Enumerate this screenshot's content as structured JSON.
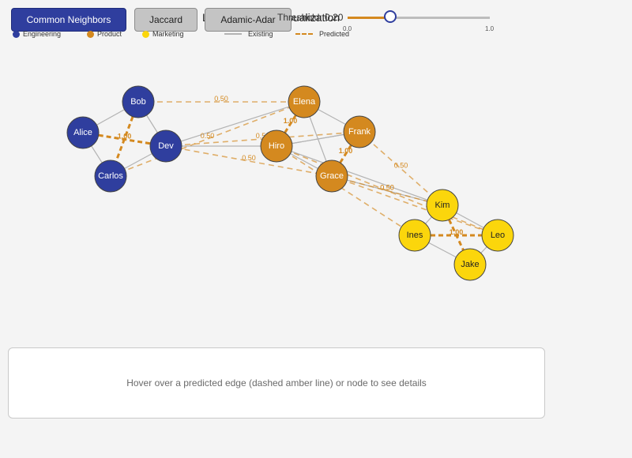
{
  "toolbar": {
    "buttons": [
      {
        "label": "Common Neighbors",
        "active": true
      },
      {
        "label": "Jaccard",
        "active": false
      },
      {
        "label": "Adamic-Adar",
        "active": false
      }
    ],
    "behind_text": "Link Prediction Visualization",
    "threshold_label": "Threshold: 0.20"
  },
  "slider": {
    "min_label": "0.0",
    "max_label": "1.0",
    "value": 0.3
  },
  "legend": {
    "departments": [
      {
        "label": "Engineering",
        "color": "#2f3e9e"
      },
      {
        "label": "Product",
        "color": "#d4891f"
      },
      {
        "label": "Marketing",
        "color": "#fbd60c"
      }
    ],
    "existing_label": "Existing",
    "predicted_label": "Predicted"
  },
  "graph": {
    "colors": {
      "engineering": "#2f3e9e",
      "product": "#d4891f",
      "marketing": "#fbd60c",
      "existing": "#b3b3b3",
      "predicted": "#d4891f"
    },
    "nodes": [
      {
        "id": "Alice",
        "dept": "engineering"
      },
      {
        "id": "Bob",
        "dept": "engineering"
      },
      {
        "id": "Carlos",
        "dept": "engineering"
      },
      {
        "id": "Dev",
        "dept": "engineering"
      },
      {
        "id": "Elena",
        "dept": "product"
      },
      {
        "id": "Frank",
        "dept": "product"
      },
      {
        "id": "Hiro",
        "dept": "product"
      },
      {
        "id": "Grace",
        "dept": "product"
      },
      {
        "id": "Kim",
        "dept": "marketing"
      },
      {
        "id": "Ines",
        "dept": "marketing"
      },
      {
        "id": "Leo",
        "dept": "marketing"
      },
      {
        "id": "Jake",
        "dept": "marketing"
      }
    ],
    "existing_edges": [
      [
        "Alice",
        "Bob"
      ],
      [
        "Alice",
        "Carlos"
      ],
      [
        "Bob",
        "Dev"
      ],
      [
        "Carlos",
        "Dev"
      ],
      [
        "Dev",
        "Hiro"
      ],
      [
        "Dev",
        "Elena"
      ],
      [
        "Hiro",
        "Frank"
      ],
      [
        "Elena",
        "Frank"
      ],
      [
        "Elena",
        "Grace"
      ],
      [
        "Frank",
        "Hiro"
      ],
      [
        "Hiro",
        "Grace"
      ],
      [
        "Grace",
        "Kim"
      ],
      [
        "Hiro",
        "Kim"
      ],
      [
        "Kim",
        "Ines"
      ],
      [
        "Kim",
        "Leo"
      ],
      [
        "Ines",
        "Jake"
      ],
      [
        "Leo",
        "Jake"
      ]
    ],
    "predicted_edges": [
      {
        "from": "Alice",
        "to": "Dev",
        "score": "1.00",
        "strong": true
      },
      {
        "from": "Bob",
        "to": "Carlos",
        "score": "",
        "strong": true
      },
      {
        "from": "Hiro",
        "to": "Elena",
        "score": "1.00",
        "strong": true
      },
      {
        "from": "Frank",
        "to": "Grace",
        "score": "1.00",
        "strong": true
      },
      {
        "from": "Ines",
        "to": "Leo",
        "score": "1.00",
        "strong": true
      },
      {
        "from": "Kim",
        "to": "Jake",
        "score": "",
        "strong": true
      },
      {
        "from": "Bob",
        "to": "Elena",
        "score": "0.50",
        "strong": false
      },
      {
        "from": "Carlos",
        "to": "Elena",
        "score": "0.50",
        "strong": false
      },
      {
        "from": "Dev",
        "to": "Frank",
        "score": "0.50",
        "strong": false
      },
      {
        "from": "Dev",
        "to": "Grace",
        "score": "0.50",
        "strong": false
      },
      {
        "from": "Frank",
        "to": "Kim",
        "score": "0.50",
        "strong": false
      },
      {
        "from": "Hiro",
        "to": "Leo",
        "score": "0.50",
        "strong": false
      },
      {
        "from": "Grace",
        "to": "Leo",
        "score": "",
        "strong": false
      },
      {
        "from": "Hiro",
        "to": "Ines",
        "score": "",
        "strong": false
      },
      {
        "from": "Grace",
        "to": "Kim",
        "score": "0.50",
        "strong": false
      }
    ]
  },
  "info_panel": {
    "text": "Hover over a predicted edge (dashed amber line) or node to see details"
  }
}
